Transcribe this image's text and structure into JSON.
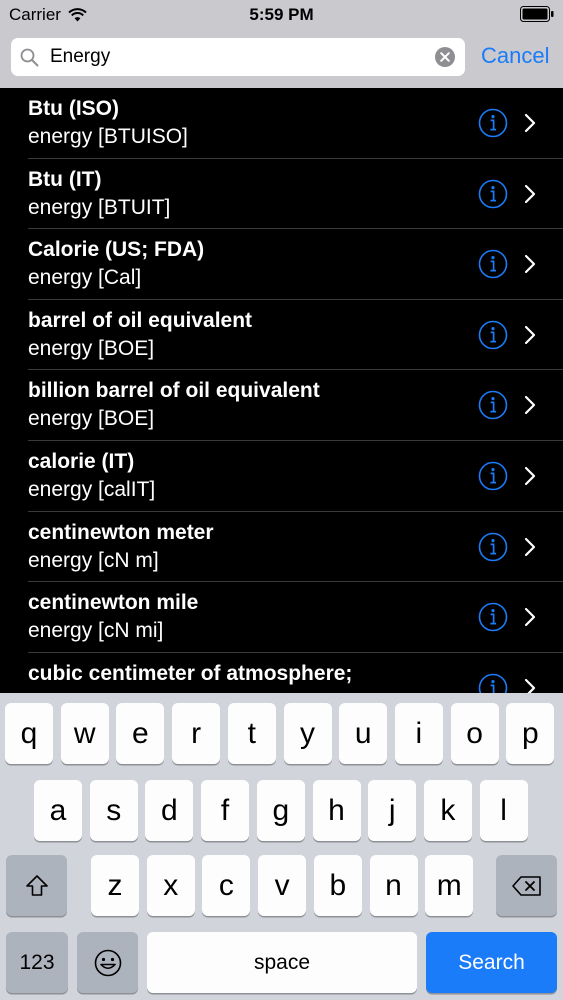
{
  "status_bar": {
    "carrier": "Carrier",
    "time": "5:59 PM"
  },
  "search": {
    "value": "Energy",
    "cancel_label": "Cancel"
  },
  "results": [
    {
      "title": "Btu (ISO)",
      "subtitle": "energy [BTUISO]"
    },
    {
      "title": "Btu (IT)",
      "subtitle": "energy [BTUIT]"
    },
    {
      "title": "Calorie (US; FDA)",
      "subtitle": "energy [Cal]"
    },
    {
      "title": "barrel of oil equivalent",
      "subtitle": "energy [BOE]"
    },
    {
      "title": "billion barrel of oil equivalent",
      "subtitle": "energy [BOE]"
    },
    {
      "title": "calorie (IT)",
      "subtitle": "energy [calIT]"
    },
    {
      "title": "centinewton meter",
      "subtitle": "energy [cN m]"
    },
    {
      "title": "centinewton mile",
      "subtitle": "energy [cN mi]"
    },
    {
      "title": "cubic centimeter of atmosphere;",
      "subtitle": ""
    }
  ],
  "keyboard": {
    "row1": [
      "q",
      "w",
      "e",
      "r",
      "t",
      "y",
      "u",
      "i",
      "o",
      "p"
    ],
    "row2": [
      "a",
      "s",
      "d",
      "f",
      "g",
      "h",
      "j",
      "k",
      "l"
    ],
    "row3": [
      "z",
      "x",
      "c",
      "v",
      "b",
      "n",
      "m"
    ],
    "numbers_label": "123",
    "space_label": "space",
    "search_label": "Search"
  },
  "colors": {
    "accent": "#1a7cf8",
    "list_background": "#000000",
    "header_background": "#c9c9ce",
    "keyboard_background": "#d1d4da"
  },
  "icons": [
    "wifi-icon",
    "battery-icon",
    "search-icon",
    "clear-icon",
    "info-icon",
    "chevron-right-icon",
    "shift-icon",
    "delete-icon",
    "emoji-icon"
  ]
}
